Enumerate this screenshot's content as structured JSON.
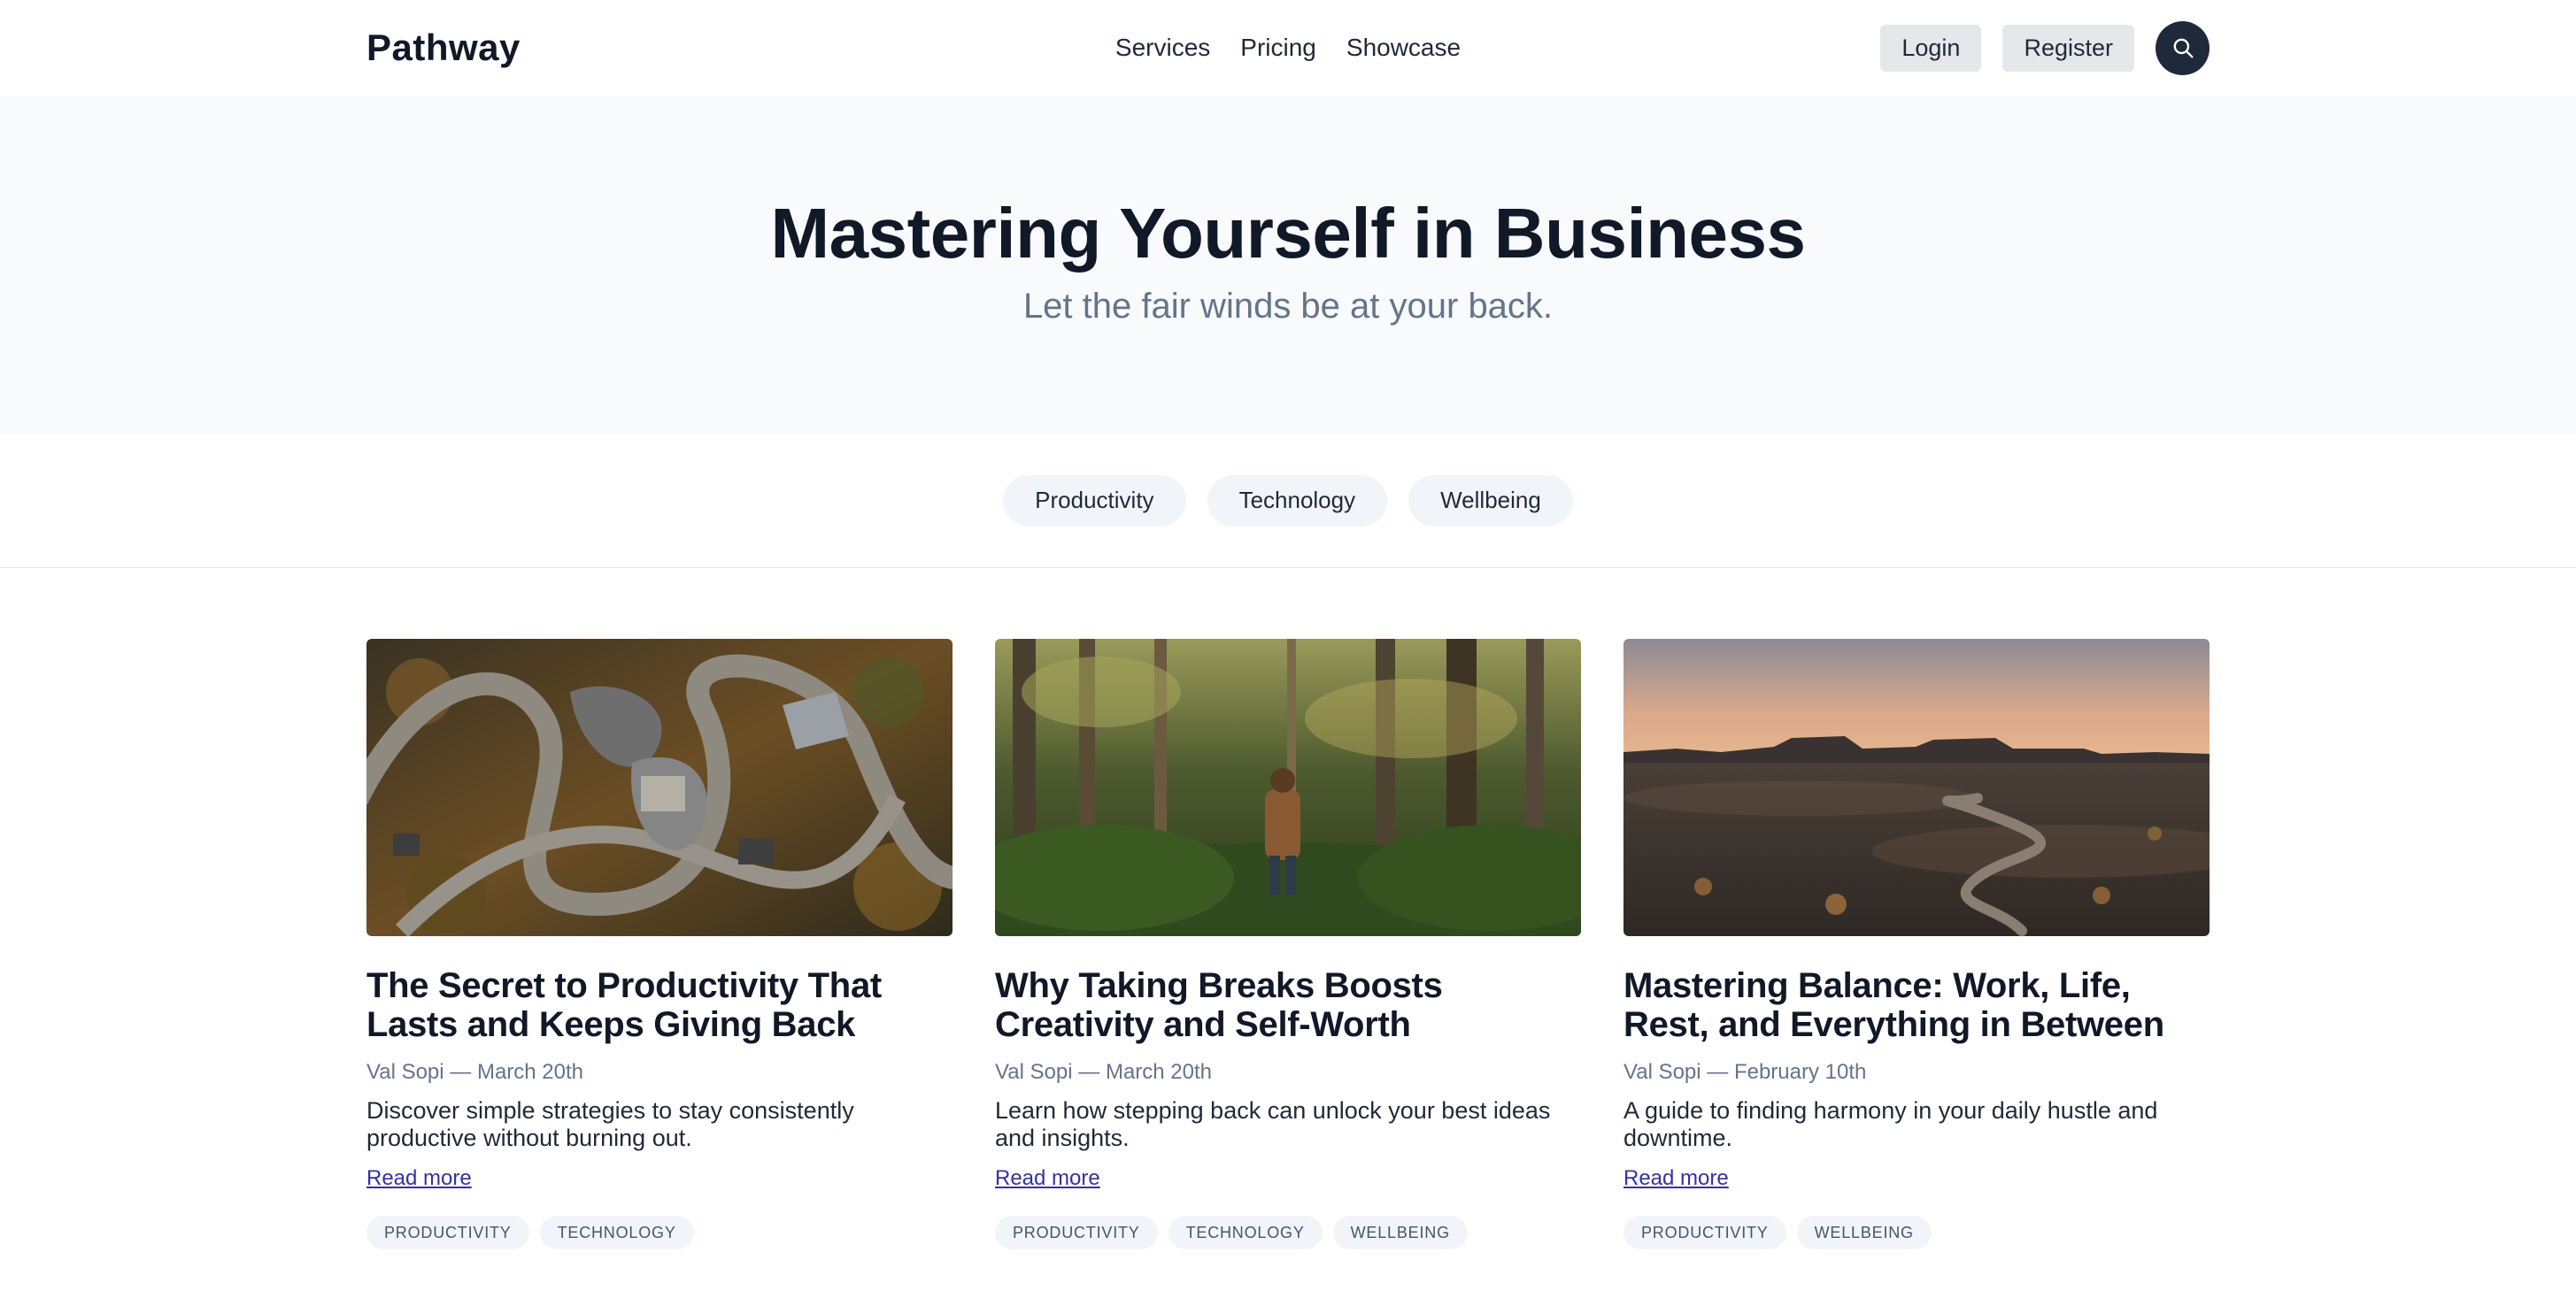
{
  "header": {
    "logo": "Pathway",
    "nav": [
      "Services",
      "Pricing",
      "Showcase"
    ],
    "login_label": "Login",
    "register_label": "Register",
    "search_icon": "search-icon"
  },
  "hero": {
    "title": "Mastering Yourself in Business",
    "subtitle": "Let the fair winds be at your back."
  },
  "filters": [
    "Productivity",
    "Technology",
    "Wellbeing"
  ],
  "cards": [
    {
      "image": "aerial view of winding paths and buildings among trees",
      "title": "The Secret to Productivity That Lasts and Keeps Giving Back",
      "meta": "Val Sopi — March 20th",
      "description": "Discover simple strategies to stay consistently productive without burning out.",
      "link": "Read more",
      "tags": [
        "PRODUCTIVITY",
        "TECHNOLOGY"
      ]
    },
    {
      "image": "person walking through a green forest",
      "title": "Why Taking Breaks Boosts Creativity and Self-Worth",
      "meta": "Val Sopi — March 20th",
      "description": "Learn how stepping back can unlock your best ideas and insights.",
      "link": "Read more",
      "tags": [
        "PRODUCTIVITY",
        "TECHNOLOGY",
        "WELLBEING"
      ]
    },
    {
      "image": "desert path leading toward mesas at dusk",
      "title": "Mastering Balance: Work, Life, Rest, and Everything in Between",
      "meta": "Val Sopi — February 10th",
      "description": "A guide to finding harmony in your daily hustle and downtime.",
      "link": "Read more",
      "tags": [
        "PRODUCTIVITY",
        "WELLBEING"
      ]
    }
  ],
  "colors": {
    "text": "#111827",
    "muted": "#64748b",
    "link": "#3730a3",
    "chip_bg": "#f1f5f9",
    "hero_bg": "#f8fafc",
    "button_bg": "#e5e7eb",
    "search_bg": "#1e293b"
  }
}
